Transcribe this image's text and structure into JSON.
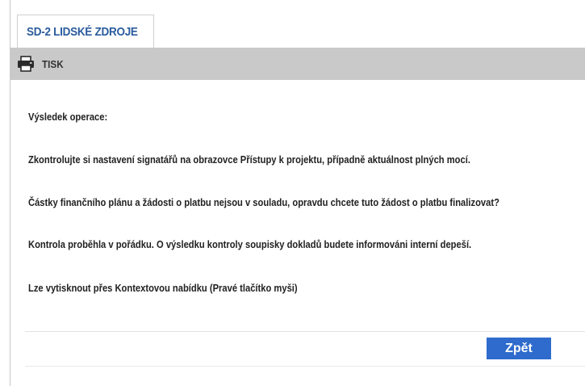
{
  "tab": {
    "label": "SD-2 LIDSKÉ ZDROJE"
  },
  "toolbar": {
    "print_icon": "printer-icon",
    "print_label": "TISK"
  },
  "messages": [
    "Výsledek operace:",
    "Zkontrolujte si nastavení signatářů na obrazovce Přístupy k projektu, případně aktuálnost plných mocí.",
    "Částky finančního plánu a žádosti o platbu nejsou v souladu, opravdu chcete tuto žádost o platbu finalizovat?",
    "Kontrola proběhla v pořádku. O výsledku kontroly soupisky dokladů budete informováni interní depeší.",
    "Lze vytisknout přes Kontextovou nabídku (Pravé tlačítko myši)"
  ],
  "actions": {
    "back_label": "Zpět"
  },
  "colors": {
    "accent": "#2e6bcc",
    "tab_text": "#2b5c9e",
    "toolbar_bg": "#c9c9c9"
  }
}
